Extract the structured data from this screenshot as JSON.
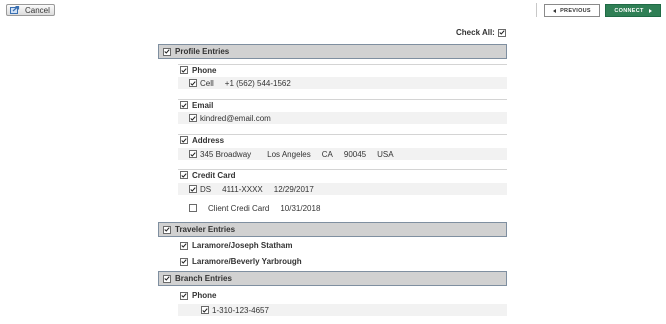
{
  "toolbar": {
    "cancel_label": "Cancel",
    "previous_label": "PREVIOUS",
    "connect_label": "CONNECT",
    "connect_color": "#2f7f55"
  },
  "check_all": {
    "label": "Check All:",
    "checked": true
  },
  "sections": {
    "profile": {
      "title": "Profile Entries",
      "phone": {
        "label": "Phone",
        "cell_type": "Cell",
        "cell_number": "+1 (562) 544-1562"
      },
      "email": {
        "label": "Email",
        "value": "kindred@email.com"
      },
      "address": {
        "label": "Address",
        "street": "345 Broadway",
        "city": "Los Angeles",
        "state": "CA",
        "zip": "90045",
        "country": "USA"
      },
      "credit_card": {
        "label": "Credit Card",
        "card1_type": "DS",
        "card1_number": "4111-XXXX",
        "card1_expiry": "12/29/2017",
        "card2_name": "Client Credi Card",
        "card2_expiry": "10/31/2018"
      }
    },
    "traveler": {
      "title": "Traveler Entries",
      "travelers": [
        "Laramore/Joseph Statham",
        "Laramore/Beverly Yarbrough"
      ]
    },
    "branch": {
      "title": "Branch Entries",
      "phone": {
        "label": "Phone",
        "number": "1-310-123-4657"
      }
    }
  },
  "colors": {
    "section_header_bg": "#d1d1d1",
    "section_header_border": "#7f8fa0",
    "row_bg": "#f2f2f2"
  }
}
